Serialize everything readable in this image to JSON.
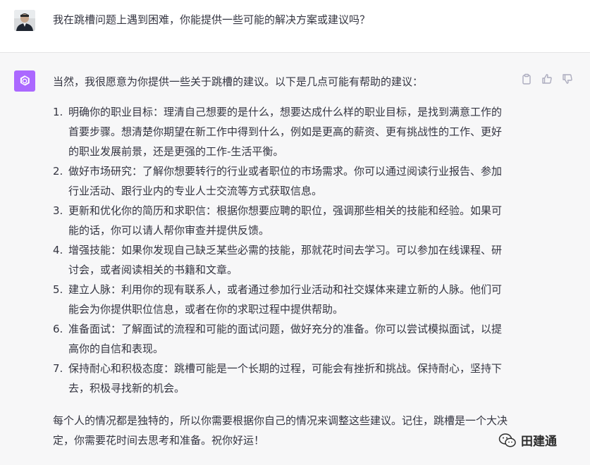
{
  "user_message": {
    "text": "我在跳槽问题上遇到困难，你能提供一些可能的解决方案或建议吗？"
  },
  "assistant_message": {
    "intro": "当然，我很愿意为你提供一些关于跳槽的建议。以下是几点可能有帮助的建议：",
    "items": [
      {
        "num": "1.",
        "text": "明确你的职业目标：理清自己想要的是什么，想要达成什么样的职业目标，是找到满意工作的首要步骤。想清楚你期望在新工作中得到什么，例如是更高的薪资、更有挑战性的工作、更好的职业发展前景，还是更强的工作-生活平衡。"
      },
      {
        "num": "2.",
        "text": "做好市场研究：了解你想要转行的行业或者职位的市场需求。你可以通过阅读行业报告、参加行业活动、跟行业内的专业人士交流等方式获取信息。"
      },
      {
        "num": "3.",
        "text": "更新和优化你的简历和求职信：根据你想要应聘的职位，强调那些相关的技能和经验。如果可能的话，你可以请人帮你审查并提供反馈。"
      },
      {
        "num": "4.",
        "text": "增强技能：如果你发现自己缺乏某些必需的技能，那就花时间去学习。可以参加在线课程、研讨会，或者阅读相关的书籍和文章。"
      },
      {
        "num": "5.",
        "text": "建立人脉：利用你的现有联系人，或者通过参加行业活动和社交媒体来建立新的人脉。他们可能会为你提供职位信息，或者在你的求职过程中提供帮助。"
      },
      {
        "num": "6.",
        "text": "准备面试：了解面试的流程和可能的面试问题，做好充分的准备。你可以尝试模拟面试，以提高你的自信和表现。"
      },
      {
        "num": "7.",
        "text": "保持耐心和积极态度：跳槽可能是一个长期的过程，可能会有挫折和挑战。保持耐心，坚持下去，积极寻找新的机会。"
      }
    ],
    "outro": "每个人的情况都是独特的，所以你需要根据你自己的情况来调整这些建议。记住，跳槽是一个大决定，你需要花时间去思考和准备。祝你好运！"
  },
  "watermark": {
    "label": "田建通"
  },
  "colors": {
    "bot_avatar": "#ab68ff",
    "bot_bg": "#f7f7f8",
    "text": "#343541",
    "icon": "#acacbe"
  }
}
